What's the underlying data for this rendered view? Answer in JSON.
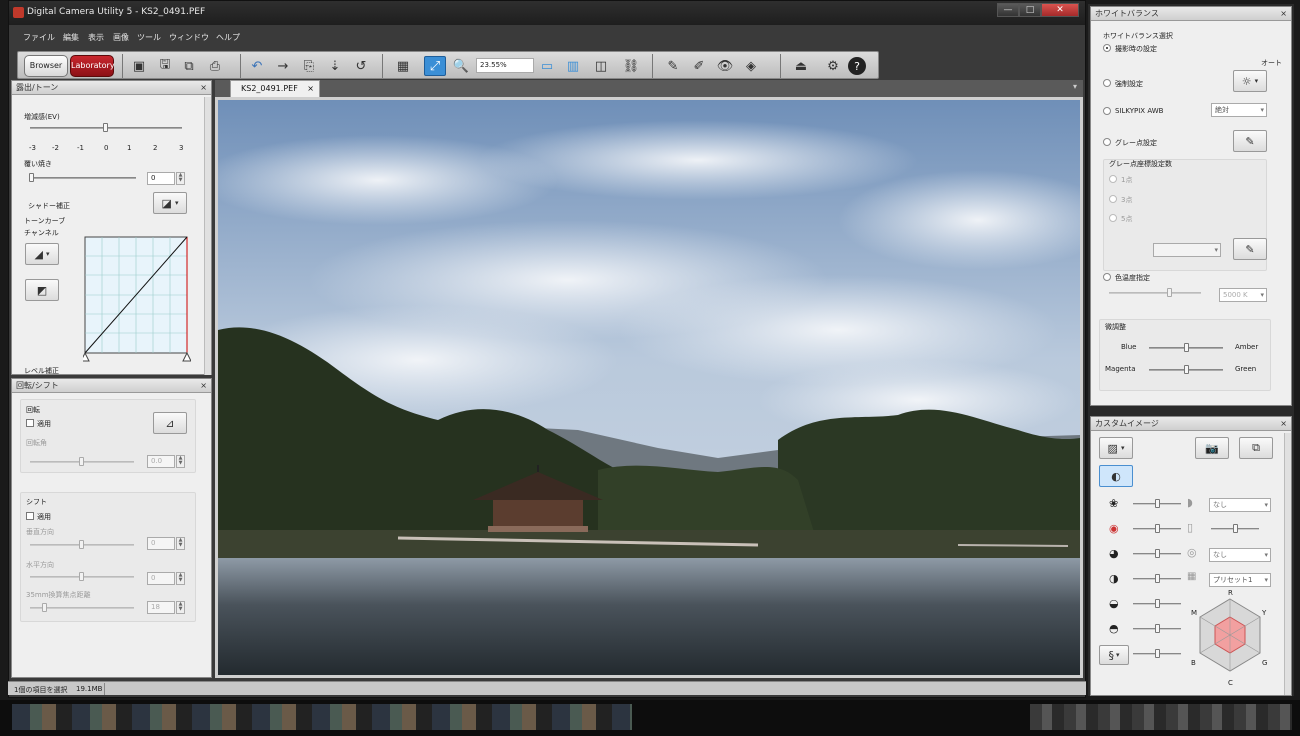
{
  "window": {
    "title": "Digital Camera Utility 5 - KS2_0491.PEF",
    "controls": [
      "—",
      "□",
      "✕"
    ]
  },
  "menu": [
    "ファイル",
    "編集",
    "表示",
    "画像",
    "ツール",
    "ウィンドウ",
    "ヘルプ"
  ],
  "toolbar": {
    "browser_label": "Browser",
    "laboratory_label": "Laboratory",
    "zoom_value": "23.55%"
  },
  "exposure_panel": {
    "title": "露出/トーン",
    "ev_label": "増減感(EV)",
    "ev_ticks": [
      "-3",
      "-2",
      "-1",
      "0",
      "1",
      "2",
      "3"
    ],
    "burn_label": "覆い焼き",
    "burn_value": "0",
    "shadow_label": "シャドー補正",
    "tone_curve_label": "トーンカーブ",
    "channel_label": "チャンネル",
    "level_label": "レベル補正"
  },
  "rotate_panel": {
    "title": "回転/シフト",
    "rotate_label": "回転",
    "apply_label": "適用",
    "angle_label": "回転角",
    "angle_value": "0.0",
    "shift_label": "シフト",
    "shift_apply_label": "適用",
    "vertical_label": "垂直方向",
    "vertical_value": "0",
    "horizontal_label": "水平方向",
    "horizontal_value": "0",
    "focal_label": "35mm換算焦点距離",
    "focal_value": "18"
  },
  "tab": {
    "name": "KS2_0491.PEF",
    "close": "×"
  },
  "status": {
    "selection": "1個の項目を選択",
    "size": "19.1MB"
  },
  "wb_panel": {
    "title": "ホワイトバランス",
    "select_label": "ホワイトバランス選択",
    "as_shot_label": "撮影時の設定",
    "auto_label": "オート",
    "forced_label": "強制設定",
    "silkypix_label": "SILKYPIX AWB",
    "silkypix_value": "絶対",
    "gray_label": "グレー点設定",
    "gray_count_label": "グレー点座標設定数",
    "gray_options": [
      "1点",
      "3点",
      "5点"
    ],
    "temp_label": "色温度指定",
    "temp_value": "5000 K",
    "fine_label": "微調整",
    "blue_label": "Blue",
    "amber_label": "Amber",
    "magenta_label": "Magenta",
    "green_label": "Green"
  },
  "custom_panel": {
    "title": "カスタムイメージ",
    "none1": "なし",
    "none2": "なし",
    "preset": "プリセット1",
    "hex_labels": [
      "R",
      "Y",
      "G",
      "C",
      "B",
      "M"
    ]
  },
  "colors": {
    "laboratory_red": "#a8151b",
    "zoom_active_blue": "#3b8fd6",
    "panel_bg": "#efefef",
    "hex_fill": "#f2a0a0"
  }
}
